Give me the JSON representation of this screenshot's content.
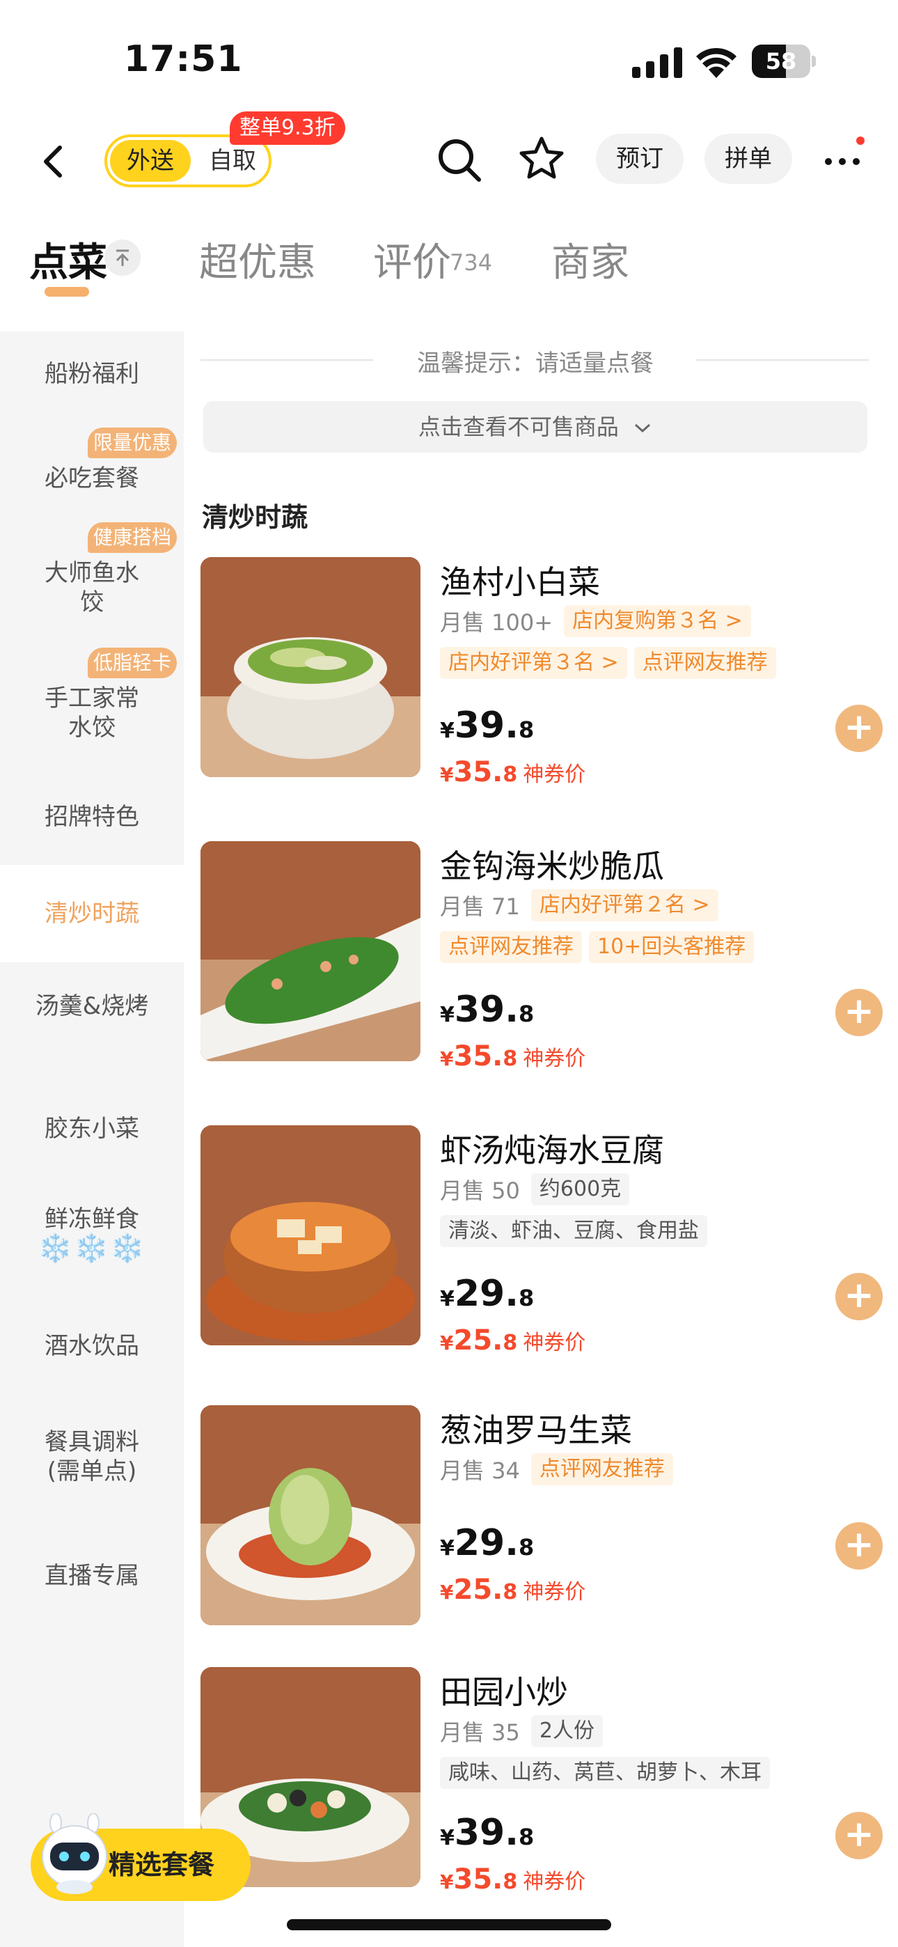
{
  "status_bar": {
    "time": "17:51",
    "battery": "58",
    "battery_level": 0.58
  },
  "nav": {
    "mode_delivery": "外送",
    "mode_pickup": "自取",
    "discount_tag": "整单9.3折",
    "reserve_label": "预订",
    "group_label": "拼单"
  },
  "tabs": {
    "menu": "点菜",
    "deals": "超优惠",
    "reviews": "评价",
    "reviews_count": "734",
    "merchant": "商家"
  },
  "sidebar": {
    "items": [
      {
        "label": "船粉福利"
      },
      {
        "label": "必吃套餐",
        "badge": "限量优惠"
      },
      {
        "label": "大师鱼水饺",
        "badge": "健康搭档"
      },
      {
        "label": "手工家常水饺",
        "badge": "低脂轻卡"
      },
      {
        "label": "招牌特色"
      },
      {
        "label": "清炒时蔬"
      },
      {
        "label": "汤羹&烧烤"
      },
      {
        "label": "胶东小菜"
      },
      {
        "label": "鲜冻鲜食"
      },
      {
        "label": "酒水饮品"
      },
      {
        "label": "餐具调料(需单点)"
      },
      {
        "label": "直播专属"
      }
    ],
    "snow": "❄️❄️❄️"
  },
  "main": {
    "tip": "温馨提示：请适量点餐",
    "unavailable": "点击查看不可售商品",
    "category": "清炒时蔬",
    "coupon_label": "神券价",
    "currency": "¥",
    "dishes": [
      {
        "name": "渔村小白菜",
        "sold": "月售 100+",
        "tags_row1": [
          "店内复购第３名 >"
        ],
        "tags_row2": [
          "店内好评第３名 >",
          "点评网友推荐"
        ],
        "price_int": "39.",
        "price_dec": "8",
        "coupon_int": "35.",
        "coupon_dec": "8"
      },
      {
        "name": "金钩海米炒脆瓜",
        "sold": "月售 71",
        "tags_row1": [
          "店内好评第２名 >"
        ],
        "tags_row2": [
          "点评网友推荐",
          "10+回头客推荐"
        ],
        "price_int": "39.",
        "price_dec": "8",
        "coupon_int": "35.",
        "coupon_dec": "8"
      },
      {
        "name": "虾汤炖海水豆腐",
        "sold": "月售 50",
        "tags_row1": [
          "约600克"
        ],
        "tags_row2": [
          "清淡、虾油、豆腐、食用盐"
        ],
        "price_int": "29.",
        "price_dec": "8",
        "coupon_int": "25.",
        "coupon_dec": "8"
      },
      {
        "name": "葱油罗马生菜",
        "sold": "月售 34",
        "tags_row1": [
          "点评网友推荐"
        ],
        "tags_row2": [],
        "price_int": "29.",
        "price_dec": "8",
        "coupon_int": "25.",
        "coupon_dec": "8"
      },
      {
        "name": "田园小炒",
        "sold": "月售 35",
        "tags_row1": [
          "2人份"
        ],
        "tags_row2": [
          "咸味、山药、莴苣、胡萝卜、木耳"
        ],
        "price_int": "39.",
        "price_dec": "8",
        "coupon_int": "35.",
        "coupon_dec": "8"
      }
    ]
  },
  "combo": {
    "label": "精选套餐"
  },
  "colors": {
    "accent_yellow": "#ffd21e",
    "accent_orange": "#f0a25d",
    "price_red": "#f44a2c",
    "discount_red": "#ff3b30"
  }
}
